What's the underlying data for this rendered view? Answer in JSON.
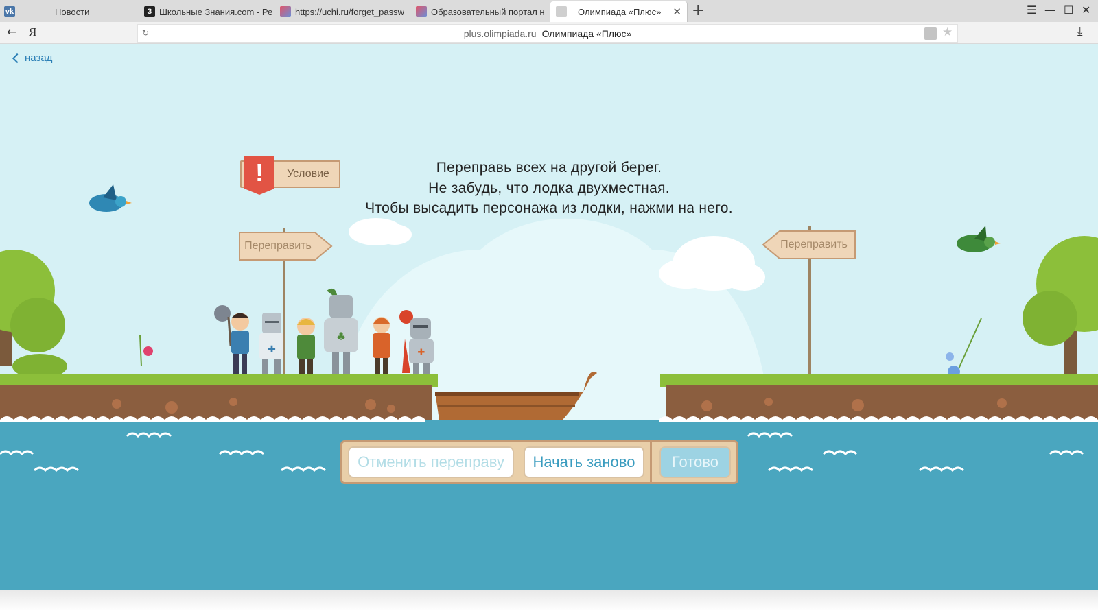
{
  "browser": {
    "tabs": [
      {
        "label": "Новости",
        "favicon": "vk-icon",
        "favicon_text": "vk",
        "color": "#4a76a8"
      },
      {
        "label": "Школьные Знания.com - Ре",
        "favicon": "znanija-icon",
        "favicon_text": "З",
        "color": "#222222"
      },
      {
        "label": "https://uchi.ru/forget_passw",
        "favicon": "uchi-icon",
        "favicon_text": "",
        "color": "#e0566a"
      },
      {
        "label": "Образовательный портал н",
        "favicon": "portal-icon",
        "favicon_text": "",
        "color": "#e0566a"
      },
      {
        "label": "Олимпиада «Плюс»",
        "favicon": "page-icon",
        "favicon_text": "",
        "color": "#cfcfcf",
        "active": true
      }
    ],
    "yandex_logo": "Я",
    "address": {
      "domain": "plus.olimpiada.ru",
      "title": "Олимпиада «Плюс»"
    }
  },
  "page": {
    "back_label": "назад",
    "instructions": [
      "Переправь всех на другой берег.",
      "Не забудь, что лодка двухместная.",
      "Чтобы высадить персонажа из лодки, нажми на него."
    ],
    "condition_label": "Условие",
    "condition_mark": "!",
    "left_sign_label": "Переправить",
    "right_sign_label": "Переправить",
    "buttons": {
      "cancel": "Отменить переправу",
      "restart": "Начать заново",
      "done": "Готово"
    }
  },
  "colors": {
    "sky": "#d6f1f5",
    "water": "#4aa6bf",
    "grass": "#8cbf3a",
    "soil": "#8b5e3f",
    "wood": "#efd6b8",
    "accent_red": "#e25444",
    "link": "#2b7fb6"
  }
}
